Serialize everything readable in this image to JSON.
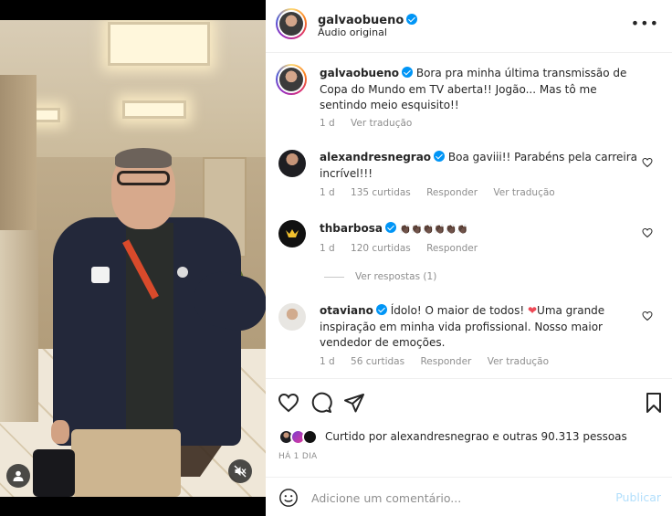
{
  "post": {
    "author": "galvaobueno",
    "audio": "Áudio original",
    "more_label": "•••"
  },
  "caption": {
    "username": "galvaobueno",
    "text": "Bora pra minha última transmissão de Copa do Mundo em TV aberta!! Jogão... Mas tô me sentindo meio esquisito!!",
    "time": "1 d",
    "translate": "Ver tradução"
  },
  "comments": [
    {
      "username": "alexandresnegrao",
      "text": "Boa gaviii!! Parabéns pela carreira incrível!!!",
      "time": "1 d",
      "likes": "135 curtidas",
      "reply": "Responder",
      "translate": "Ver tradução"
    },
    {
      "username": "thbarbosa",
      "text": "",
      "emoji": "👏🏿👏🏿👏🏿👏🏿👏🏿👏🏿",
      "time": "1 d",
      "likes": "120 curtidas",
      "reply": "Responder"
    },
    {
      "username": "otaviano",
      "text": "Ídolo! O maior de todos! ",
      "heart": "❤",
      "text2": "Uma grande inspiração em minha vida profissional. Nosso maior vendedor de emoções.",
      "time": "1 d",
      "likes": "56 curtidas",
      "reply": "Responder",
      "translate": "Ver tradução"
    }
  ],
  "view_replies": "Ver respostas (1)",
  "liked_by": "Curtido por alexandresnegrao e outras 90.313 pessoas",
  "posted_ago": "HÁ 1 DIA",
  "add_comment": {
    "placeholder": "Adicione um comentário...",
    "publish": "Publicar"
  },
  "colors": {
    "verified": "#0095f6",
    "publish_disabled": "#b2dffc",
    "heart": "#ed4956",
    "muted_text": "#8e8e8e"
  },
  "icons": [
    "user-tag-icon",
    "mute-icon",
    "more-icon",
    "heart-icon",
    "comment-icon",
    "share-icon",
    "bookmark-icon",
    "emoji-icon"
  ]
}
